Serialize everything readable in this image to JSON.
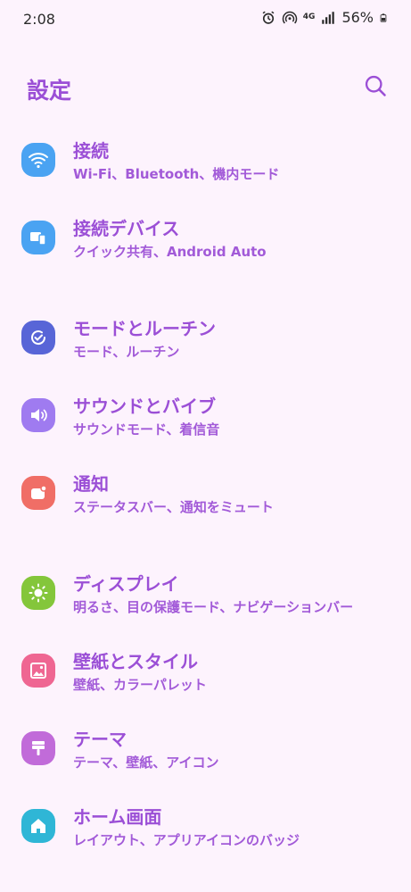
{
  "status": {
    "time": "2:08",
    "network": "4G",
    "battery": "56%"
  },
  "header": {
    "title": "設定"
  },
  "groups": [
    [
      {
        "title": "接続",
        "subtitle": "Wi-Fi、Bluetooth、機内モード",
        "icon": "wifi-icon",
        "color": "#4aa3f2"
      },
      {
        "title": "接続デバイス",
        "subtitle": "クイック共有、Android Auto",
        "icon": "devices-icon",
        "color": "#4aa3f2"
      }
    ],
    [
      {
        "title": "モードとルーチン",
        "subtitle": "モード、ルーチン",
        "icon": "modes-check-icon",
        "color": "#5865d7"
      },
      {
        "title": "サウンドとバイブ",
        "subtitle": "サウンドモード、着信音",
        "icon": "speaker-icon",
        "color": "#9f7bf0"
      },
      {
        "title": "通知",
        "subtitle": "ステータスバー、通知をミュート",
        "icon": "notification-icon",
        "color": "#f06e66"
      }
    ],
    [
      {
        "title": "ディスプレイ",
        "subtitle": "明るさ、目の保護モード、ナビゲーションバー",
        "icon": "sun-icon",
        "color": "#84c63b"
      },
      {
        "title": "壁紙とスタイル",
        "subtitle": "壁紙、カラーパレット",
        "icon": "image-icon",
        "color": "#ef6692"
      },
      {
        "title": "テーマ",
        "subtitle": "テーマ、壁紙、アイコン",
        "icon": "brush-icon",
        "color": "#c16bd9"
      },
      {
        "title": "ホーム画面",
        "subtitle": "レイアウト、アプリアイコンのバッジ",
        "icon": "home-icon",
        "color": "#2fb6d6"
      }
    ]
  ]
}
